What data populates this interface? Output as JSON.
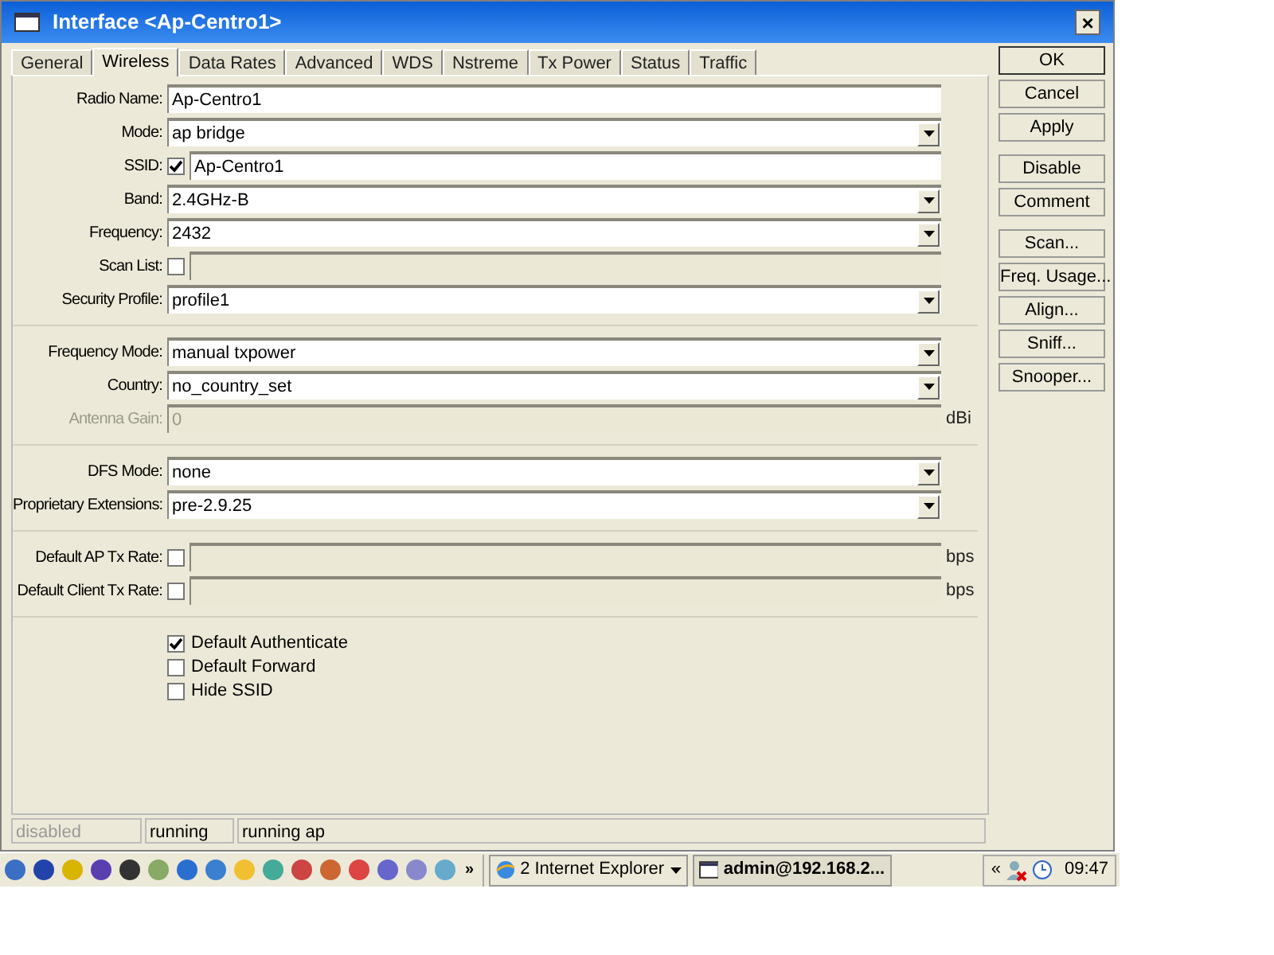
{
  "window": {
    "title": "Interface <Ap-Centro1>",
    "close": "×"
  },
  "tabs": [
    {
      "label": "General",
      "selected": false
    },
    {
      "label": "Wireless",
      "selected": true
    },
    {
      "label": "Data Rates",
      "selected": false
    },
    {
      "label": "Advanced",
      "selected": false
    },
    {
      "label": "WDS",
      "selected": false
    },
    {
      "label": "Nstreme",
      "selected": false
    },
    {
      "label": "Tx Power",
      "selected": false
    },
    {
      "label": "Status",
      "selected": false
    },
    {
      "label": "Traffic",
      "selected": false
    }
  ],
  "groups": [
    [
      {
        "label": "Radio Name:",
        "kind": "text",
        "value": "Ap-Centro1"
      },
      {
        "label": "Mode:",
        "kind": "select",
        "value": "ap bridge"
      },
      {
        "label": "SSID:",
        "kind": "check_text",
        "checked": true,
        "value": "Ap-Centro1"
      },
      {
        "label": "Band:",
        "kind": "select",
        "value": "2.4GHz-B"
      },
      {
        "label": "Frequency:",
        "kind": "select",
        "value": "2432"
      },
      {
        "label": "Scan List:",
        "kind": "check_text",
        "checked": false
      },
      {
        "label": "Security Profile:",
        "kind": "select",
        "value": "profile1"
      }
    ],
    [
      {
        "label": "Frequency Mode:",
        "kind": "select",
        "value": "manual txpower"
      },
      {
        "label": "Country:",
        "kind": "select",
        "value": "no_country_set"
      },
      {
        "label": "Antenna Gain:",
        "kind": "text",
        "value": "0",
        "disabled": true,
        "unit": "dBi"
      }
    ],
    [
      {
        "label": "DFS Mode:",
        "kind": "select",
        "value": "none"
      },
      {
        "label": "Proprietary Extensions:",
        "kind": "select",
        "value": "pre-2.9.25"
      }
    ],
    [
      {
        "label": "Default AP Tx Rate:",
        "kind": "check_text",
        "checked": false,
        "unit": "bps"
      },
      {
        "label": "Default Client Tx Rate:",
        "kind": "check_text",
        "checked": false,
        "unit": "bps"
      }
    ]
  ],
  "options": [
    {
      "label": "Default Authenticate",
      "checked": true
    },
    {
      "label": "Default Forward",
      "checked": false
    },
    {
      "label": "Hide SSID",
      "checked": false
    }
  ],
  "buttons": [
    [
      "OK",
      "Cancel",
      "Apply"
    ],
    [
      "Disable",
      "Comment"
    ],
    [
      "Scan...",
      "Freq. Usage...",
      "Align...",
      "Sniff...",
      "Snooper..."
    ]
  ],
  "status_bar": [
    {
      "text": "disabled",
      "disabled": true
    },
    {
      "text": "running",
      "disabled": false
    },
    {
      "text": "running ap",
      "disabled": false
    }
  ],
  "taskbar": {
    "more": "»",
    "tasks": [
      {
        "label": "2 Internet Explorer",
        "kind": "group",
        "selected": false
      },
      {
        "label": "admin@192.168.2...",
        "kind": "window",
        "selected": true
      }
    ],
    "tray_expand": "«",
    "clock": "09:47"
  }
}
